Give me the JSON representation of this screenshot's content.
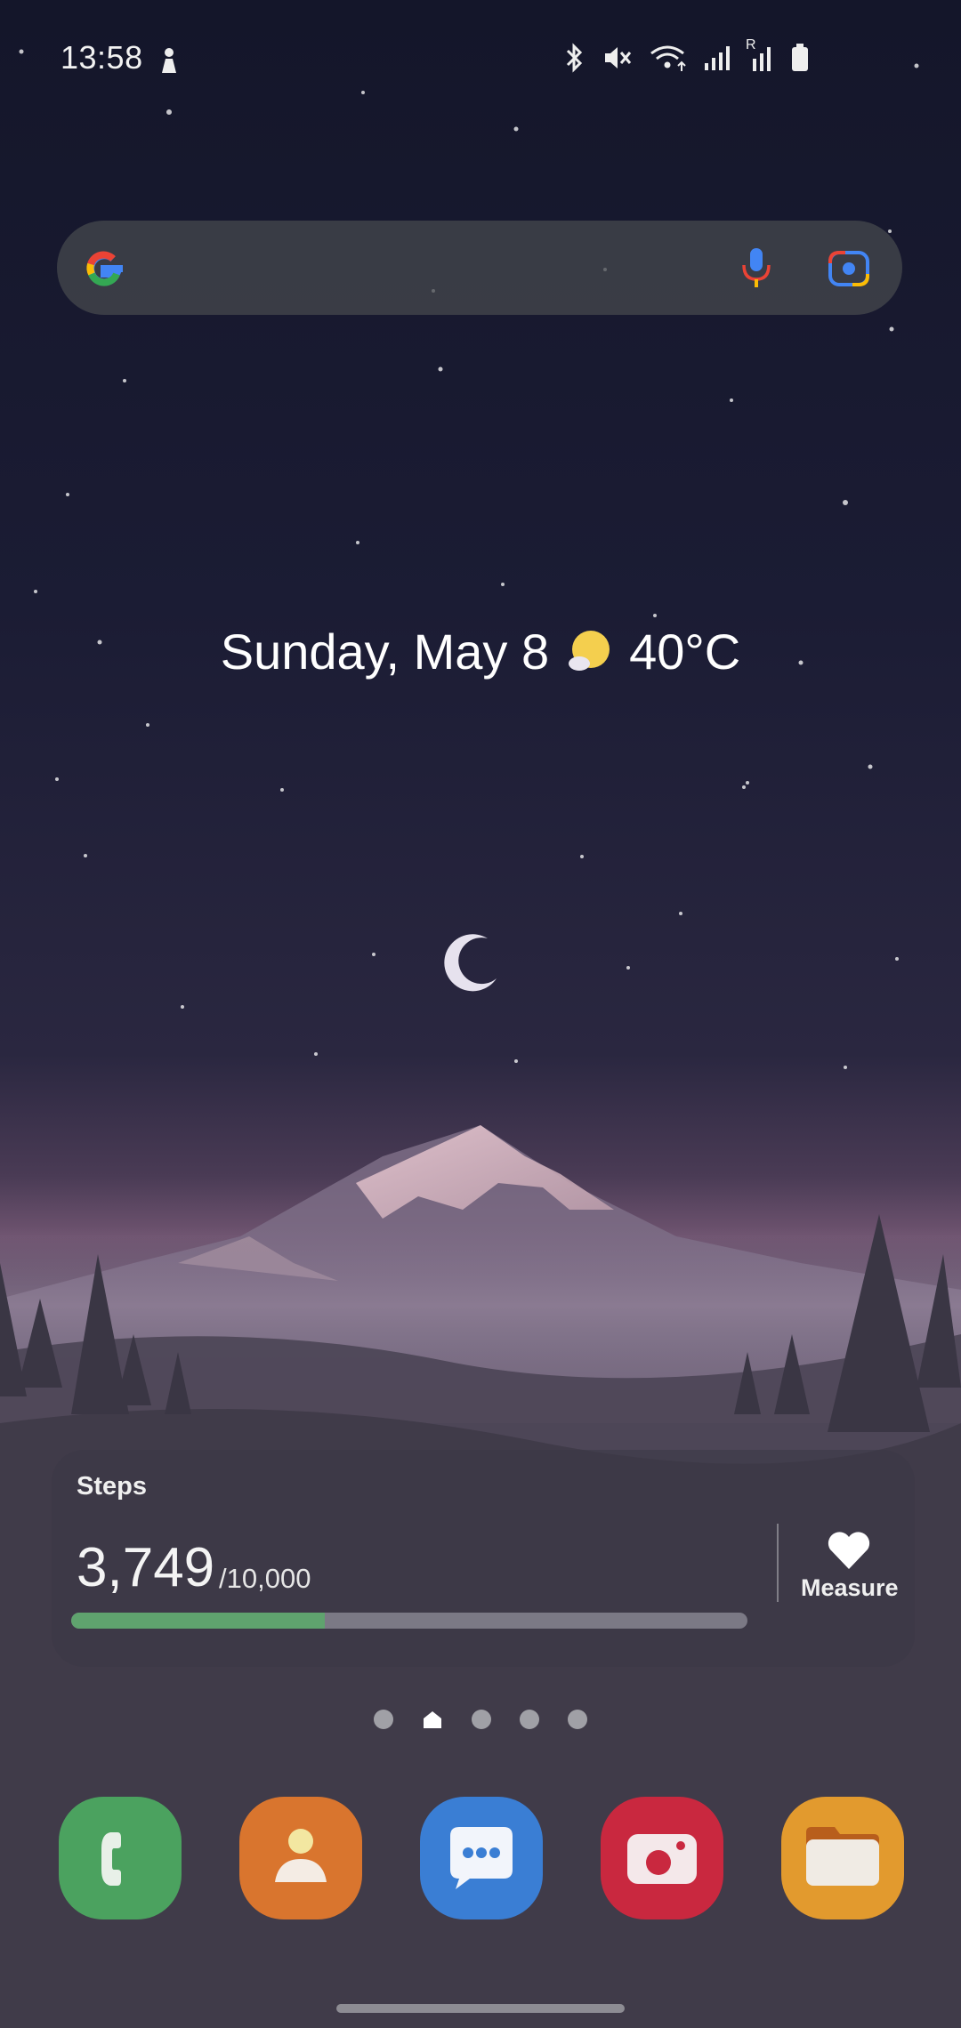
{
  "status_bar": {
    "time": "13:58",
    "icons": [
      "person-notification-icon",
      "bluetooth-icon",
      "mute-icon",
      "wifi-icon",
      "signal-icon",
      "roaming-signal-icon",
      "battery-icon"
    ],
    "roaming_label": "R"
  },
  "search_widget": {
    "logo": "google-g-icon",
    "mic_icon": "microphone-icon",
    "lens_icon": "camera-lens-icon"
  },
  "date_weather": {
    "date": "Sunday, May 8",
    "weather_icon": "sun-cloud-icon",
    "temperature": "40°C"
  },
  "steps": {
    "title": "Steps",
    "count": "3,749",
    "goal": "/10,000",
    "progress_fraction": 0.3749,
    "progress_color": "#5fa36e",
    "measure_label": "Measure",
    "measure_icon": "heart-icon"
  },
  "pages": {
    "count": 5,
    "home_index": 1
  },
  "dock": {
    "apps": [
      {
        "name": "phone",
        "icon": "phone-icon",
        "color": "#4ba25f"
      },
      {
        "name": "contacts",
        "icon": "contacts-icon",
        "color": "#d9752e"
      },
      {
        "name": "messages",
        "icon": "messages-icon",
        "color": "#3a7ed4"
      },
      {
        "name": "camera",
        "icon": "camera-icon",
        "color": "#c9283f"
      },
      {
        "name": "files",
        "icon": "folder-icon",
        "color": "#e29a2e"
      }
    ]
  }
}
